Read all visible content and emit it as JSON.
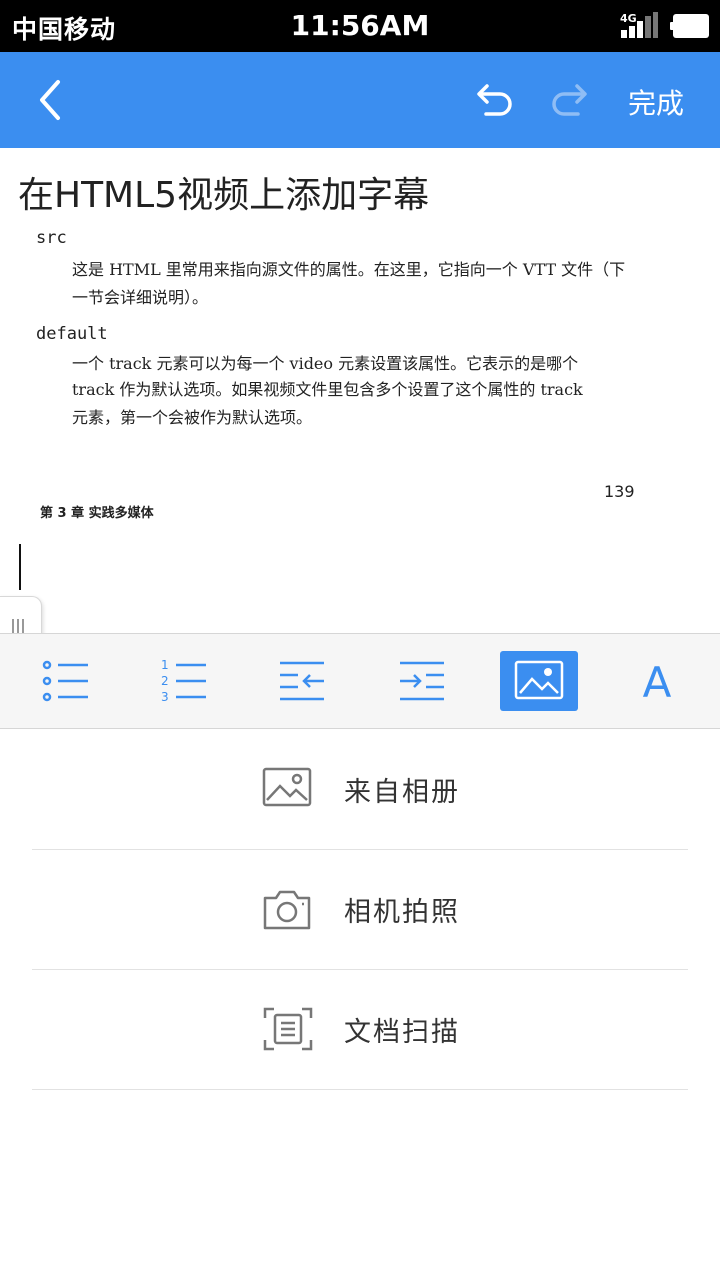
{
  "status_bar": {
    "carrier": "中国移动",
    "time": "11:56AM",
    "network": "4G"
  },
  "nav": {
    "done_label": "完成"
  },
  "doc": {
    "title": "在HTML5视频上添加字幕",
    "image_lines": [
      "src",
      "这是 HTML 里常用来指向源文件的属性。在这里，它指向一个 VTT 文件（下",
      "一节会详细说明）。",
      "default",
      "一个 track 元素可以为每一个 video 元素设置该属性。它表示的是哪个",
      "track 作为默认选项。如果视频文件里包含多个设置了这个属性的 track",
      "元素，第一个会被作为默认选项。",
      "第 3 章    实践多媒体",
      "139"
    ]
  },
  "toolbar": {
    "items": [
      "bulleted-list",
      "numbered-list",
      "outdent",
      "indent",
      "insert-image",
      "font"
    ],
    "font_label": "A",
    "active_item": "insert-image",
    "accent_color": "#3b8ef0"
  },
  "insert_menu": {
    "items": [
      {
        "icon": "photo-album-icon",
        "label": "来自相册"
      },
      {
        "icon": "camera-icon",
        "label": "相机拍照"
      },
      {
        "icon": "document-scan-icon",
        "label": "文档扫描"
      }
    ]
  }
}
